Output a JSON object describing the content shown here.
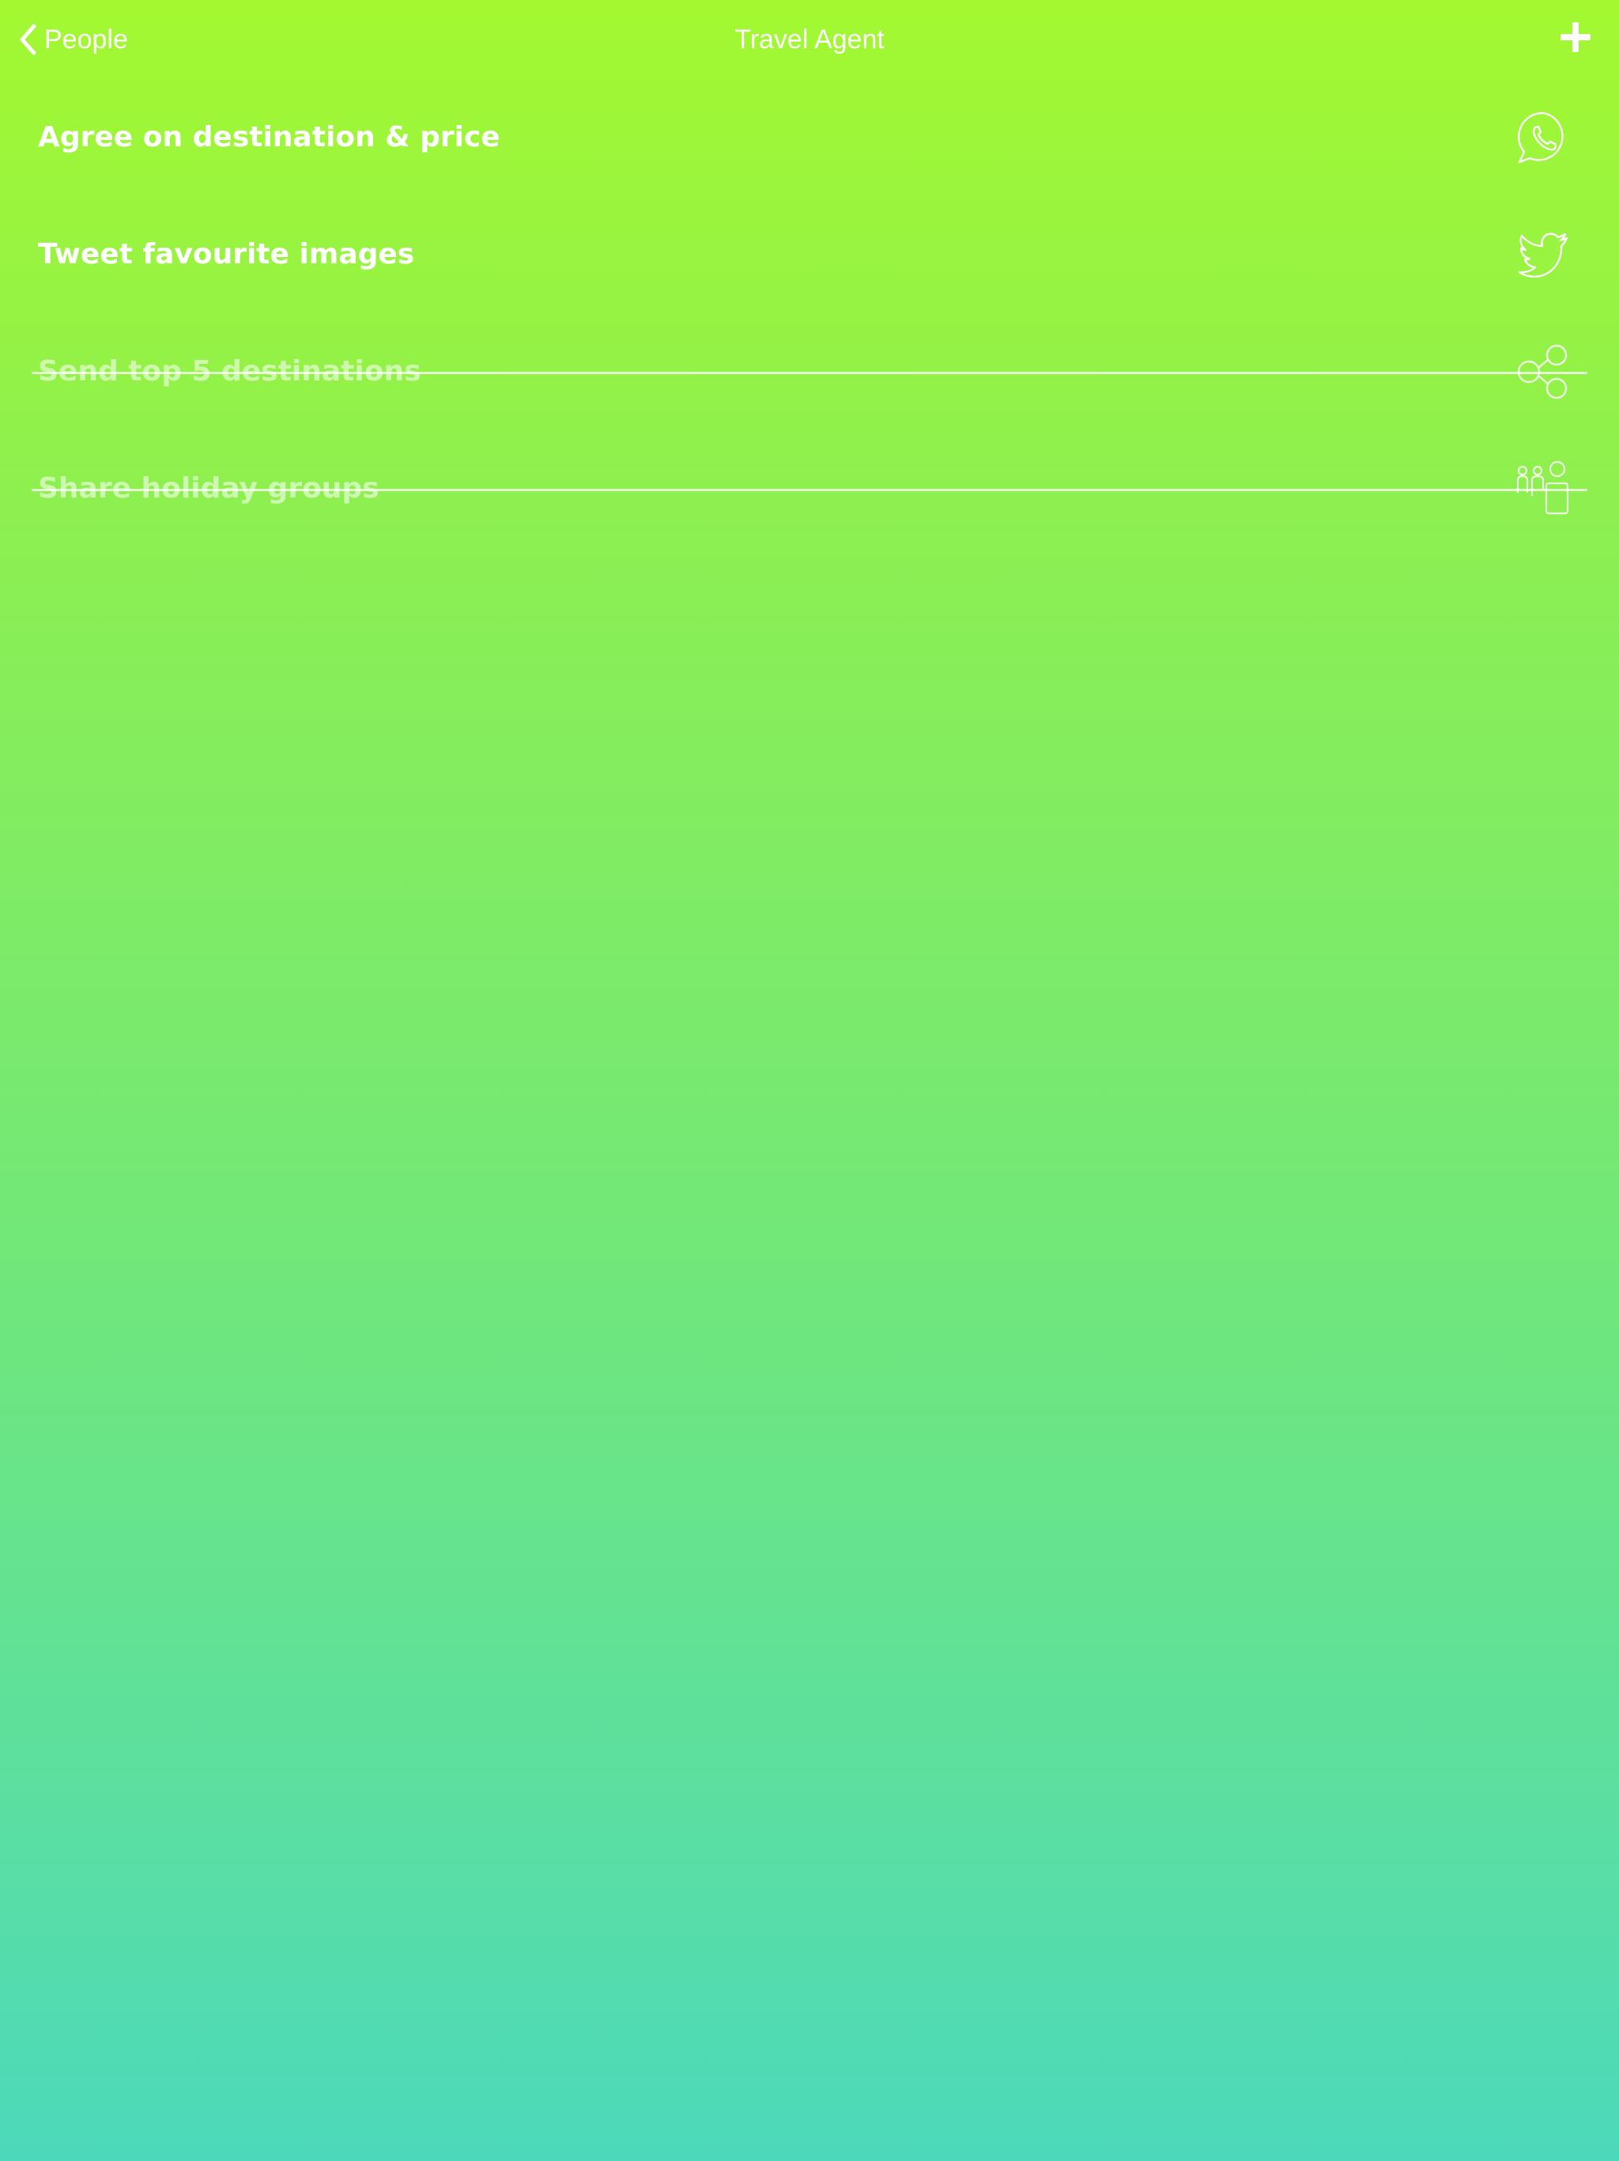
{
  "nav": {
    "back_label": "People",
    "title": "Travel Agent",
    "back_icon": "chevron-left-icon",
    "add_icon": "plus-icon"
  },
  "tasks": [
    {
      "label": "Agree on destination & price",
      "icon": "whatsapp-icon",
      "completed": false
    },
    {
      "label": "Tweet favourite images",
      "icon": "twitter-icon",
      "completed": false
    },
    {
      "label": "Send top 5 destinations",
      "icon": "share-icon",
      "completed": true
    },
    {
      "label": "Share holiday groups",
      "icon": "group-people-icon",
      "completed": true
    }
  ],
  "colors": {
    "gradient_top": "#a3f830",
    "gradient_bottom": "#4cd9bb",
    "text": "#ffffff"
  }
}
